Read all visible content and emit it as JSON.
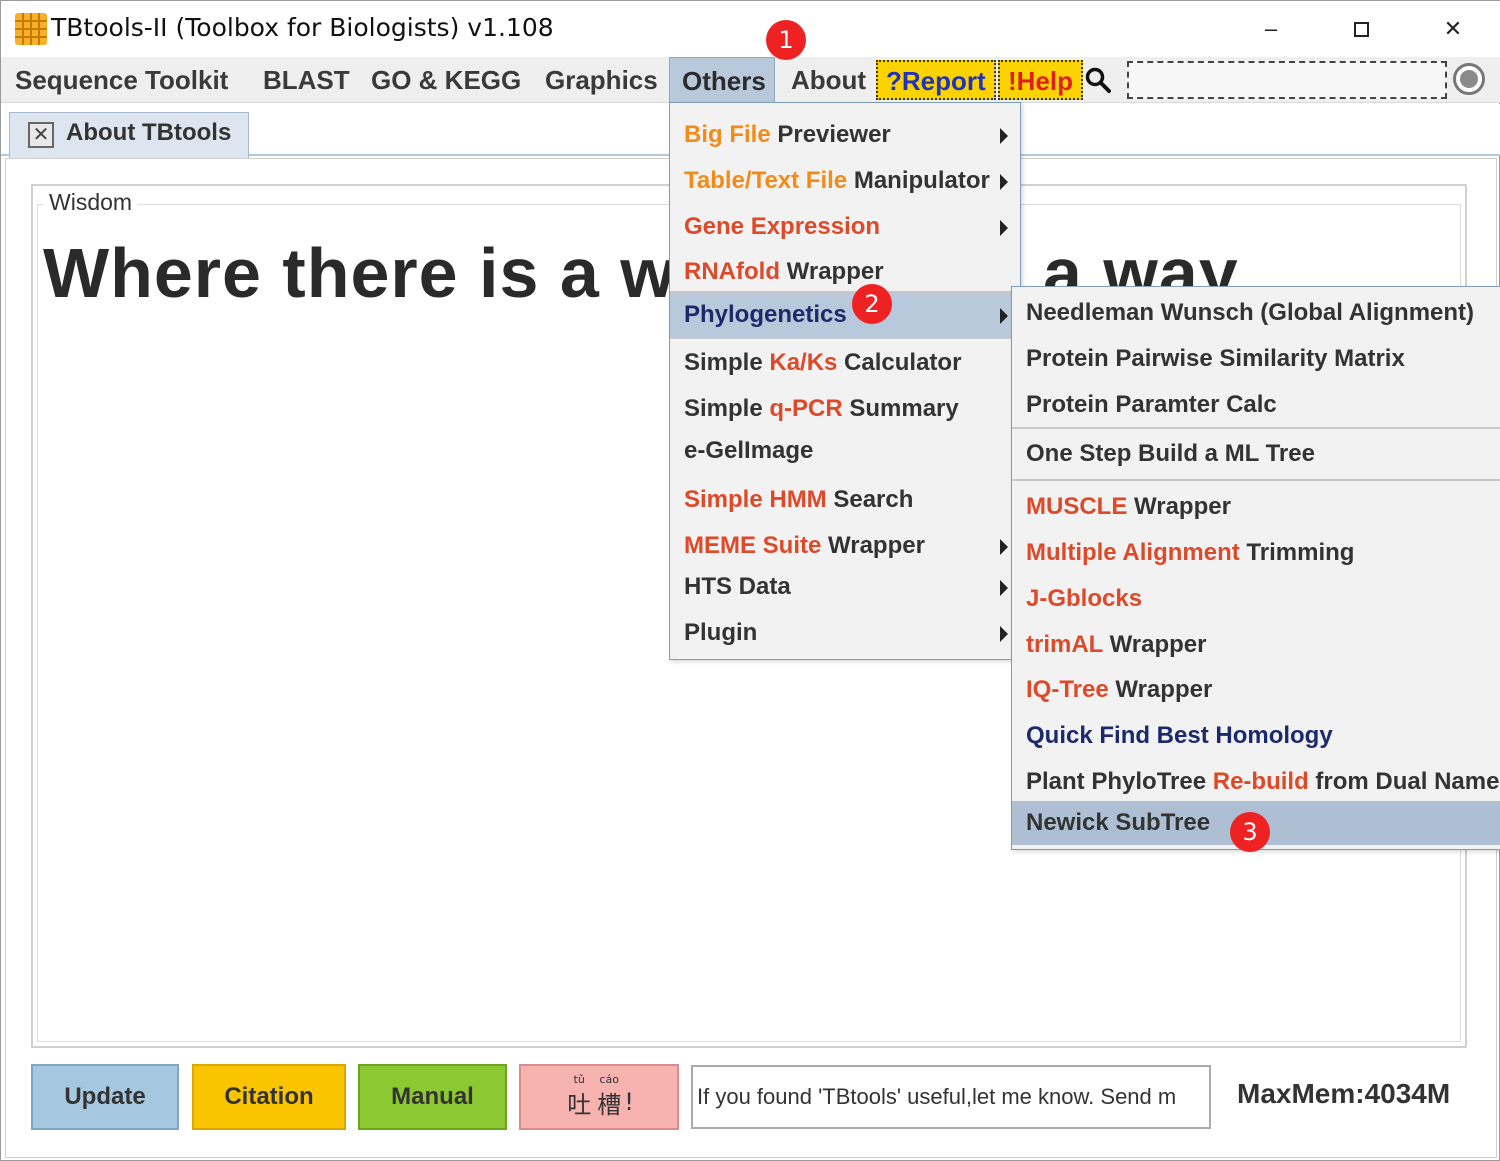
{
  "window": {
    "title": "TBtools-II (Toolbox for Biologists) v1.108",
    "controls": {
      "minimize": "–",
      "close": "✕"
    }
  },
  "menubar": {
    "items": [
      "Sequence Toolkit",
      "BLAST",
      "GO & KEGG",
      "Graphics",
      "Others",
      "About"
    ],
    "active": "Others",
    "report": "?Report",
    "help": "!Help",
    "search_value": ""
  },
  "tab": {
    "label": "About TBtools",
    "close_glyph": "✕"
  },
  "wisdom": {
    "legend": "Wisdom",
    "quote_visible_left": "Where there is a w",
    "quote_visible_right": "a way"
  },
  "others_menu": {
    "items": [
      {
        "parts": [
          {
            "t": "Big File",
            "c": "orange"
          },
          {
            "t": " Previewer",
            "c": "dark"
          }
        ],
        "submenu": true
      },
      {
        "parts": [
          {
            "t": "Table/Text File",
            "c": "orange"
          },
          {
            "t": " Manipulator",
            "c": "dark"
          }
        ],
        "submenu": true
      },
      {
        "parts": [
          {
            "t": "Gene Expression",
            "c": "red"
          }
        ],
        "submenu": true
      },
      {
        "parts": [
          {
            "t": "RNAfold",
            "c": "red"
          },
          {
            "t": " Wrapper",
            "c": "dark"
          }
        ],
        "submenu": false
      },
      {
        "parts": [
          {
            "t": "Phylogenetics",
            "c": "navy"
          }
        ],
        "submenu": true,
        "highlighted": true
      },
      {
        "parts": [
          {
            "t": "Simple ",
            "c": "dark"
          },
          {
            "t": "Ka/Ks",
            "c": "red"
          },
          {
            "t": " Calculator",
            "c": "dark"
          }
        ],
        "submenu": false
      },
      {
        "parts": [
          {
            "t": "Simple ",
            "c": "dark"
          },
          {
            "t": "q-PCR",
            "c": "red"
          },
          {
            "t": " Summary",
            "c": "dark"
          }
        ],
        "submenu": false
      },
      {
        "parts": [
          {
            "t": "e-GelImage",
            "c": "dark"
          }
        ],
        "submenu": false
      },
      {
        "parts": [
          {
            "t": "Simple ",
            "c": "red"
          },
          {
            "t": "HMM",
            "c": "red"
          },
          {
            "t": " Search",
            "c": "dark"
          }
        ],
        "submenu": false
      },
      {
        "parts": [
          {
            "t": "MEME Suite",
            "c": "red"
          },
          {
            "t": " Wrapper",
            "c": "dark"
          }
        ],
        "submenu": true
      },
      {
        "parts": [
          {
            "t": "HTS Data",
            "c": "dark"
          }
        ],
        "submenu": true
      },
      {
        "parts": [
          {
            "t": "Plugin",
            "c": "dark"
          }
        ],
        "submenu": true
      }
    ]
  },
  "phylogenetics_menu": {
    "items": [
      {
        "parts": [
          {
            "t": "Needleman Wunsch (Global Alignment)",
            "c": "dark"
          }
        ]
      },
      {
        "parts": [
          {
            "t": "Protein Pairwise Similarity Matrix",
            "c": "dark"
          }
        ]
      },
      {
        "parts": [
          {
            "t": "Protein Paramter Calc",
            "c": "dark"
          }
        ]
      },
      {
        "parts": [
          {
            "t": "One Step Build a ML Tree",
            "c": "dark"
          }
        ]
      },
      {
        "parts": [
          {
            "t": "MUSCLE",
            "c": "red"
          },
          {
            "t": " Wrapper",
            "c": "dark"
          }
        ]
      },
      {
        "parts": [
          {
            "t": "Multiple Alignment",
            "c": "red"
          },
          {
            "t": " Trimming",
            "c": "dark"
          }
        ]
      },
      {
        "parts": [
          {
            "t": "J-Gblocks",
            "c": "red"
          }
        ]
      },
      {
        "parts": [
          {
            "t": "trimAL",
            "c": "red"
          },
          {
            "t": " Wrapper",
            "c": "dark"
          }
        ]
      },
      {
        "parts": [
          {
            "t": "IQ-Tree",
            "c": "red"
          },
          {
            "t": " Wrapper",
            "c": "dark"
          }
        ]
      },
      {
        "parts": [
          {
            "t": "Quick Find Best Homology",
            "c": "navy"
          }
        ]
      },
      {
        "parts": [
          {
            "t": "Plant PhyloTree ",
            "c": "dark"
          },
          {
            "t": "Re-build",
            "c": "red"
          },
          {
            "t": " from Dual Names",
            "c": "dark"
          }
        ]
      },
      {
        "parts": [
          {
            "t": "Newick SubTree",
            "c": "dark"
          }
        ],
        "highlighted": true
      }
    ]
  },
  "bottom": {
    "update": "Update",
    "citation": "Citation",
    "manual": "Manual",
    "tucao_ruby": [
      "tǔ",
      "cáo"
    ],
    "tucao_chars": [
      "吐",
      "槽"
    ],
    "tucao_bang": "!",
    "message": "If you found 'TBtools' useful,let me know. Send m",
    "maxmem": "MaxMem:4034M"
  },
  "steps": [
    "1",
    "2",
    "3"
  ],
  "colors": {
    "menu_highlight": "#b9c9dc",
    "report_bg": "#fbd301",
    "orange_label": "#f28c18",
    "red_label": "#dd4a2a",
    "step_marker": "#ee2222"
  }
}
